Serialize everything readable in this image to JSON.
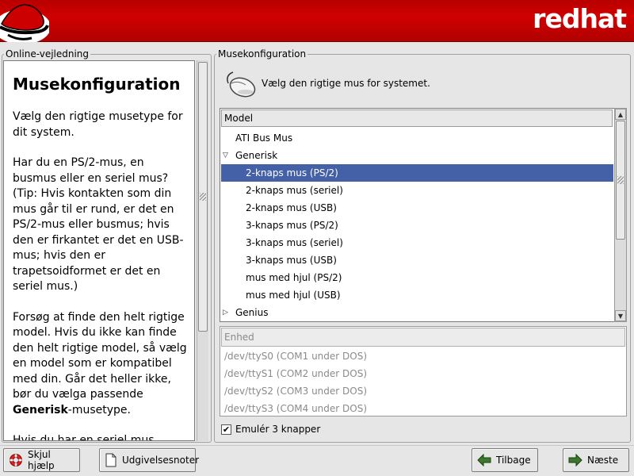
{
  "header": {
    "brand": "redhat"
  },
  "help": {
    "frame_label": "Online-vejledning",
    "title": "Musekonfiguration",
    "paragraphs": [
      "Vælg den rigtige musetype for dit system.",
      "Har du en PS/2-mus, en busmus eller en seriel mus? (Tip: Hvis kontakten som din mus går til er rund, er det en PS/2-mus eller busmus; hvis den er firkantet er det en USB-mus; hvis den er trapetsoidformet er det en seriel mus.)",
      "Forsøg at finde den helt rigtige model. Hvis du ikke kan finde den helt rigtige model, så vælg en model som er kompatibel med din. Går det heller ikke, bør du vælga passende",
      "Hvis du har en seriel mus"
    ],
    "generic_bold": "Generisk",
    "generic_tail": "-musetype."
  },
  "mouse": {
    "frame_label": "Musekonfiguration",
    "prompt": "Vælg den rigtige mus for systemet.",
    "column_header": "Model",
    "rows": [
      {
        "label": "ATI Bus Mus",
        "level": 0,
        "expander": "",
        "selected": false
      },
      {
        "label": "Generisk",
        "level": 0,
        "expander": "open",
        "selected": false
      },
      {
        "label": "2-knaps mus (PS/2)",
        "level": 1,
        "expander": "",
        "selected": true
      },
      {
        "label": "2-knaps mus (seriel)",
        "level": 1,
        "expander": "",
        "selected": false
      },
      {
        "label": "2-knaps mus (USB)",
        "level": 1,
        "expander": "",
        "selected": false
      },
      {
        "label": "3-knaps mus (PS/2)",
        "level": 1,
        "expander": "",
        "selected": false
      },
      {
        "label": "3-knaps mus (seriel)",
        "level": 1,
        "expander": "",
        "selected": false
      },
      {
        "label": "3-knaps mus (USB)",
        "level": 1,
        "expander": "",
        "selected": false
      },
      {
        "label": "mus med hjul (PS/2)",
        "level": 1,
        "expander": "",
        "selected": false
      },
      {
        "label": "mus med hjul (USB)",
        "level": 1,
        "expander": "",
        "selected": false
      },
      {
        "label": "Genius",
        "level": 0,
        "expander": "closed",
        "selected": false
      }
    ],
    "device_header": "Enhed",
    "devices": [
      "/dev/ttyS0 (COM1 under DOS)",
      "/dev/ttyS1 (COM2 under DOS)",
      "/dev/ttyS2 (COM3 under DOS)",
      "/dev/ttyS3 (COM4 under DOS)"
    ],
    "emulate_label": "Emulér 3 knapper",
    "emulate_checked": true
  },
  "buttons": {
    "hide_help": "Skjul hjælp",
    "release_notes": "Udgivelsesnoter",
    "back": "Tilbage",
    "next": "Næste"
  },
  "colors": {
    "banner": "#c80000",
    "selection": "#4461a8"
  }
}
